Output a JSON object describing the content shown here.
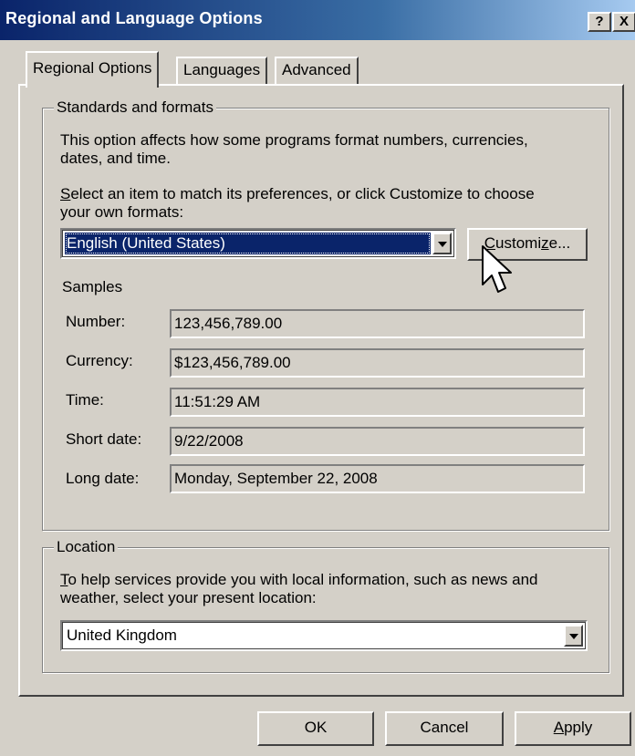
{
  "window": {
    "title": "Regional and Language Options",
    "help_glyph": "?",
    "close_glyph": "X"
  },
  "tabs": [
    {
      "label": "Regional Options",
      "active": true
    },
    {
      "label": "Languages",
      "active": false
    },
    {
      "label": "Advanced",
      "active": false
    }
  ],
  "standards": {
    "group_label": "Standards and formats",
    "intro_line1": "This option affects how some programs format numbers, currencies,",
    "intro_line2": "dates, and time.",
    "select_mnemonic": "S",
    "select_line1_rest": "elect an item to match its preferences, or click Customize to choose",
    "select_line2": "your own formats:",
    "format_value": "English (United States)",
    "customize_mnemonic": "C",
    "customize_rest": "ustomi",
    "customize_mnemonic2": "z",
    "customize_tail": "e...",
    "samples_label": "Samples",
    "samples": [
      {
        "label": "Number:",
        "value": "123,456,789.00"
      },
      {
        "label": "Currency:",
        "value": "$123,456,789.00"
      },
      {
        "label": "Time:",
        "value": "11:51:29 AM"
      },
      {
        "label": "Short date:",
        "value": "9/22/2008"
      },
      {
        "label": "Long date:",
        "value": "Monday, September 22, 2008"
      }
    ]
  },
  "location": {
    "group_label": "Location",
    "line1_mnemonic": "T",
    "line1_rest": "o help services provide you with local information, such as news and",
    "line2": "weather, select your present location:",
    "value": "United Kingdom"
  },
  "buttons": {
    "ok": "OK",
    "cancel": "Cancel",
    "apply_mnemonic": "A",
    "apply_rest": "pply"
  },
  "icons": {
    "cursor": "mouse-pointer-icon",
    "dropdown": "chevron-down-icon"
  }
}
